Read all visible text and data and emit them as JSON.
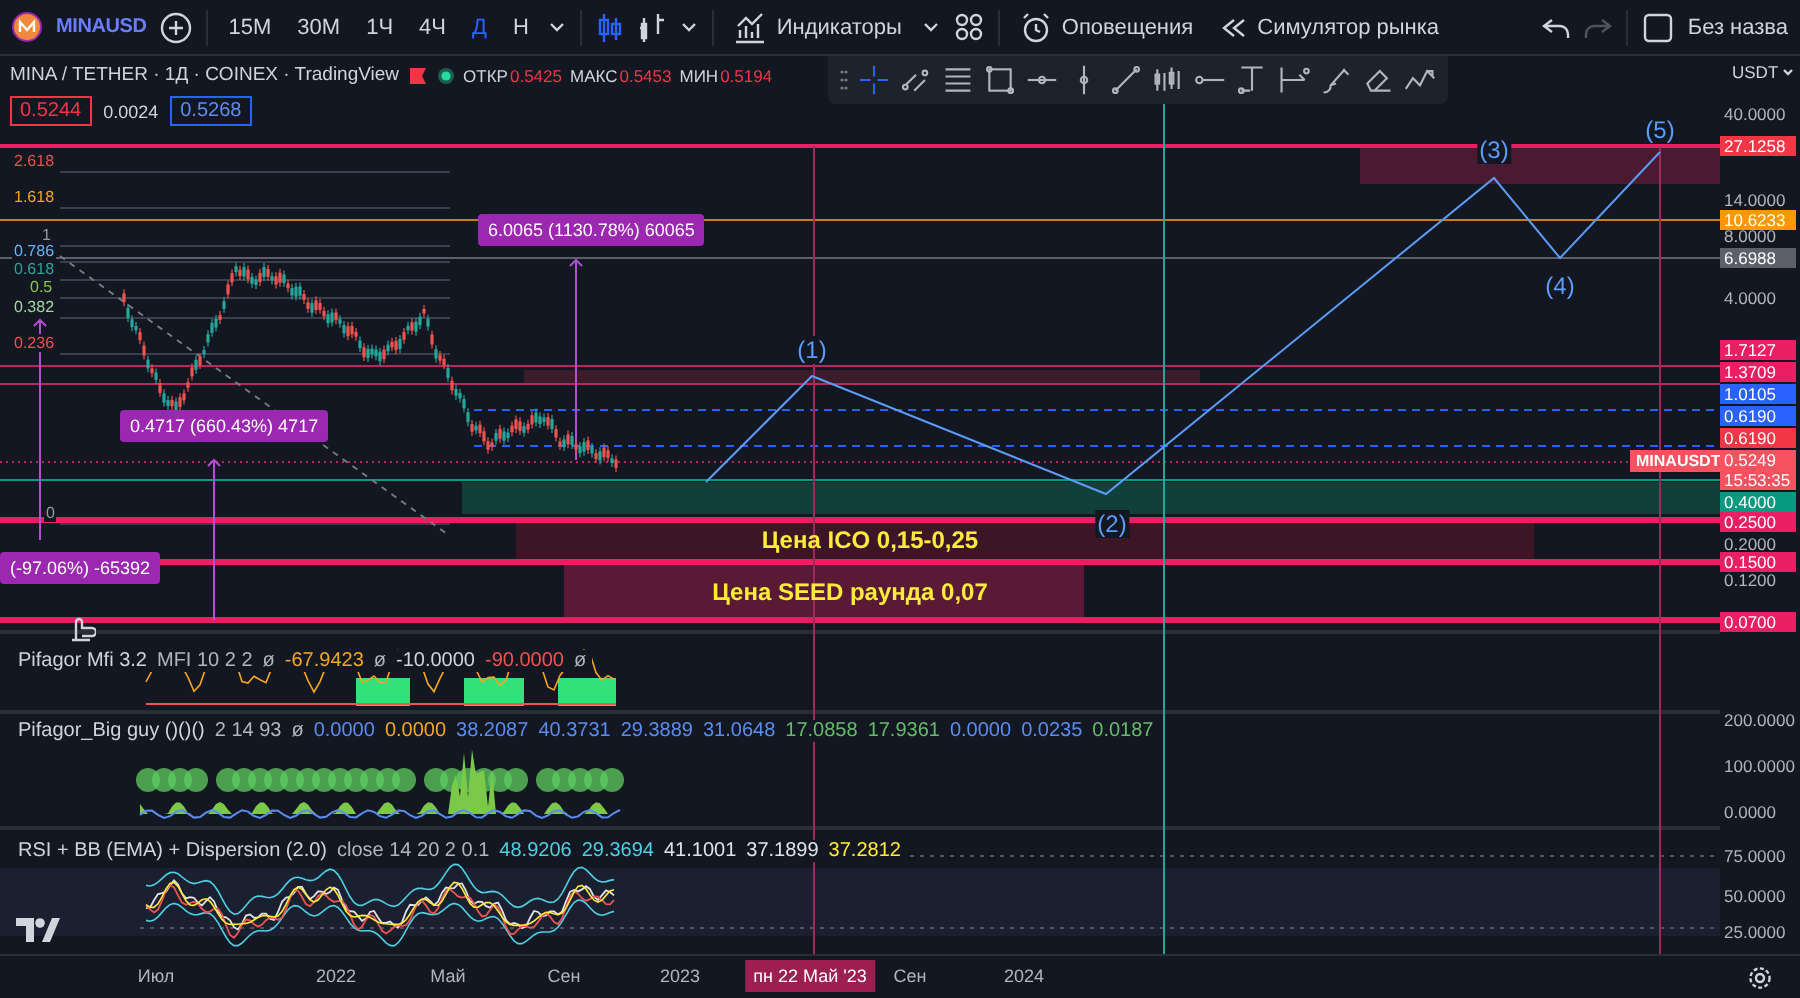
{
  "toolbar": {
    "symbol": "MINAUSD",
    "intervals": [
      {
        "label": "15M",
        "selected": false
      },
      {
        "label": "30M",
        "selected": false
      },
      {
        "label": "1Ч",
        "selected": false
      },
      {
        "label": "4Ч",
        "selected": false
      },
      {
        "label": "Д",
        "selected": true
      },
      {
        "label": "Н",
        "selected": false
      }
    ],
    "indicators_button": "Индикаторы",
    "alerts_button": "Оповещения",
    "replay_button": "Симулятор рынка",
    "layout_name": "Без назва"
  },
  "drawing_tools": [
    {
      "selected": true
    },
    {
      "selected": false
    },
    {
      "selected": false
    },
    {
      "selected": false
    },
    {
      "selected": false
    },
    {
      "selected": false
    },
    {
      "selected": false
    },
    {
      "selected": false
    },
    {
      "selected": false
    },
    {
      "selected": false
    },
    {
      "selected": false
    },
    {
      "selected": false
    },
    {
      "selected": false
    },
    {
      "selected": false
    }
  ],
  "legend": {
    "title": "MINA / TETHER · 1Д · COINEX · TradingView",
    "ohlc": [
      {
        "label": "ОТКР",
        "value": "0.5425"
      },
      {
        "label": "МАКС",
        "value": "0.5453"
      },
      {
        "label": "МИН",
        "value": "0.5194"
      }
    ],
    "bid": "0.5244",
    "spread": "0.0024",
    "ask": "0.5268"
  },
  "fib_levels": [
    {
      "label": "2.618",
      "color": "#e5534b"
    },
    {
      "label": "1.618",
      "color": "#f5a623"
    },
    {
      "label": "1",
      "color": "#9598a1"
    },
    {
      "label": "0.786",
      "color": "#64b5f6"
    },
    {
      "label": "0.618",
      "color": "#26a69a"
    },
    {
      "label": "0.5",
      "color": "#8bc34a"
    },
    {
      "label": "0.382",
      "color": "#a5d6a7"
    },
    {
      "label": "0.236",
      "color": "#ef5350"
    },
    {
      "label": "0",
      "color": "#9598a1"
    }
  ],
  "measurements": [
    "6.0065 (1130.78%) 60065",
    "0.4717 (660.43%) 4717",
    "(-97.06%) -65392"
  ],
  "wave_labels": [
    "(1)",
    "(2)",
    "(3)",
    "(4)",
    "(5)"
  ],
  "zones": [
    "Цена ICO 0,15-0,25",
    "Цена SEED раунда 0,07"
  ],
  "symbol_tag": "MINAUSDT",
  "indicators": [
    {
      "name": "Pifagor Mfi 3.2",
      "params": "MFI 10 2 2",
      "values": [
        {
          "text": "ø",
          "color": "#b2b5be"
        },
        {
          "text": "-67.9423",
          "color": "#f5a623"
        },
        {
          "text": "ø",
          "color": "#b2b5be"
        },
        {
          "text": "-10.0000",
          "color": "#d1d4dc"
        },
        {
          "text": "-90.0000",
          "color": "#ef5350"
        },
        {
          "text": "ø",
          "color": "#b2b5be"
        }
      ]
    },
    {
      "name": "Pifagor_Big guy ()()()",
      "params": "2 14 93",
      "values": [
        {
          "text": "ø",
          "color": "#b2b5be"
        },
        {
          "text": "0.0000",
          "color": "#5b8def"
        },
        {
          "text": "0.0000",
          "color": "#f5a623"
        },
        {
          "text": "38.2087",
          "color": "#5b8def"
        },
        {
          "text": "40.3731",
          "color": "#5b8def"
        },
        {
          "text": "29.3889",
          "color": "#5b8def"
        },
        {
          "text": "31.0648",
          "color": "#5b8def"
        },
        {
          "text": "17.0858",
          "color": "#66bb6a"
        },
        {
          "text": "17.9361",
          "color": "#66bb6a"
        },
        {
          "text": "0.0000",
          "color": "#5b8def"
        },
        {
          "text": "0.0235",
          "color": "#5b8def"
        },
        {
          "text": "0.0187",
          "color": "#66bb6a"
        }
      ]
    },
    {
      "name": "RSI + BB (EMA) + Dispersion (2.0)",
      "params": "close 14 20 2 0.1",
      "values": [
        {
          "text": "48.9206",
          "color": "#4dd0e1"
        },
        {
          "text": "29.3694",
          "color": "#4dd0e1"
        },
        {
          "text": "41.1001",
          "color": "#e0e3eb"
        },
        {
          "text": "37.1899",
          "color": "#e0e3eb"
        },
        {
          "text": "37.2812",
          "color": "#ffeb3b"
        }
      ]
    }
  ],
  "price_axis": {
    "currency": "USDT",
    "ticks": [
      "40.0000",
      "14.0000",
      "8.0000",
      "4.0000",
      "0.2000",
      "0.1200",
      "200.0000",
      "100.0000",
      "0.0000",
      "75.0000",
      "50.0000",
      "25.0000"
    ],
    "tags": [
      {
        "text": "27.1258",
        "color": "#f23645"
      },
      {
        "text": "10.6233",
        "color": "#ff9800"
      },
      {
        "text": "6.6988",
        "color": "#5d606b"
      },
      {
        "text": "1.7127",
        "color": "#e91e63"
      },
      {
        "text": "1.3709",
        "color": "#e91e63"
      },
      {
        "text": "1.0105",
        "color": "#2962ff"
      },
      {
        "text": "0.6190",
        "color": "#2962ff"
      },
      {
        "text": "0.6190",
        "color": "#f23645"
      },
      {
        "text": "0.5249",
        "countdown": "15:53:35",
        "color": "#f7525f"
      },
      {
        "text": "0.4000",
        "color": "#089981"
      },
      {
        "text": "0.2500",
        "color": "#e91e63"
      },
      {
        "text": "0.1500",
        "color": "#e91e63"
      },
      {
        "text": "0.0700",
        "color": "#e91e63"
      }
    ]
  },
  "time_axis": {
    "ticks": [
      "Июл",
      "2022",
      "Май",
      "Сен",
      "2023",
      "Сен",
      "2024"
    ],
    "crosshair_date": "пн 22 Май '23"
  }
}
